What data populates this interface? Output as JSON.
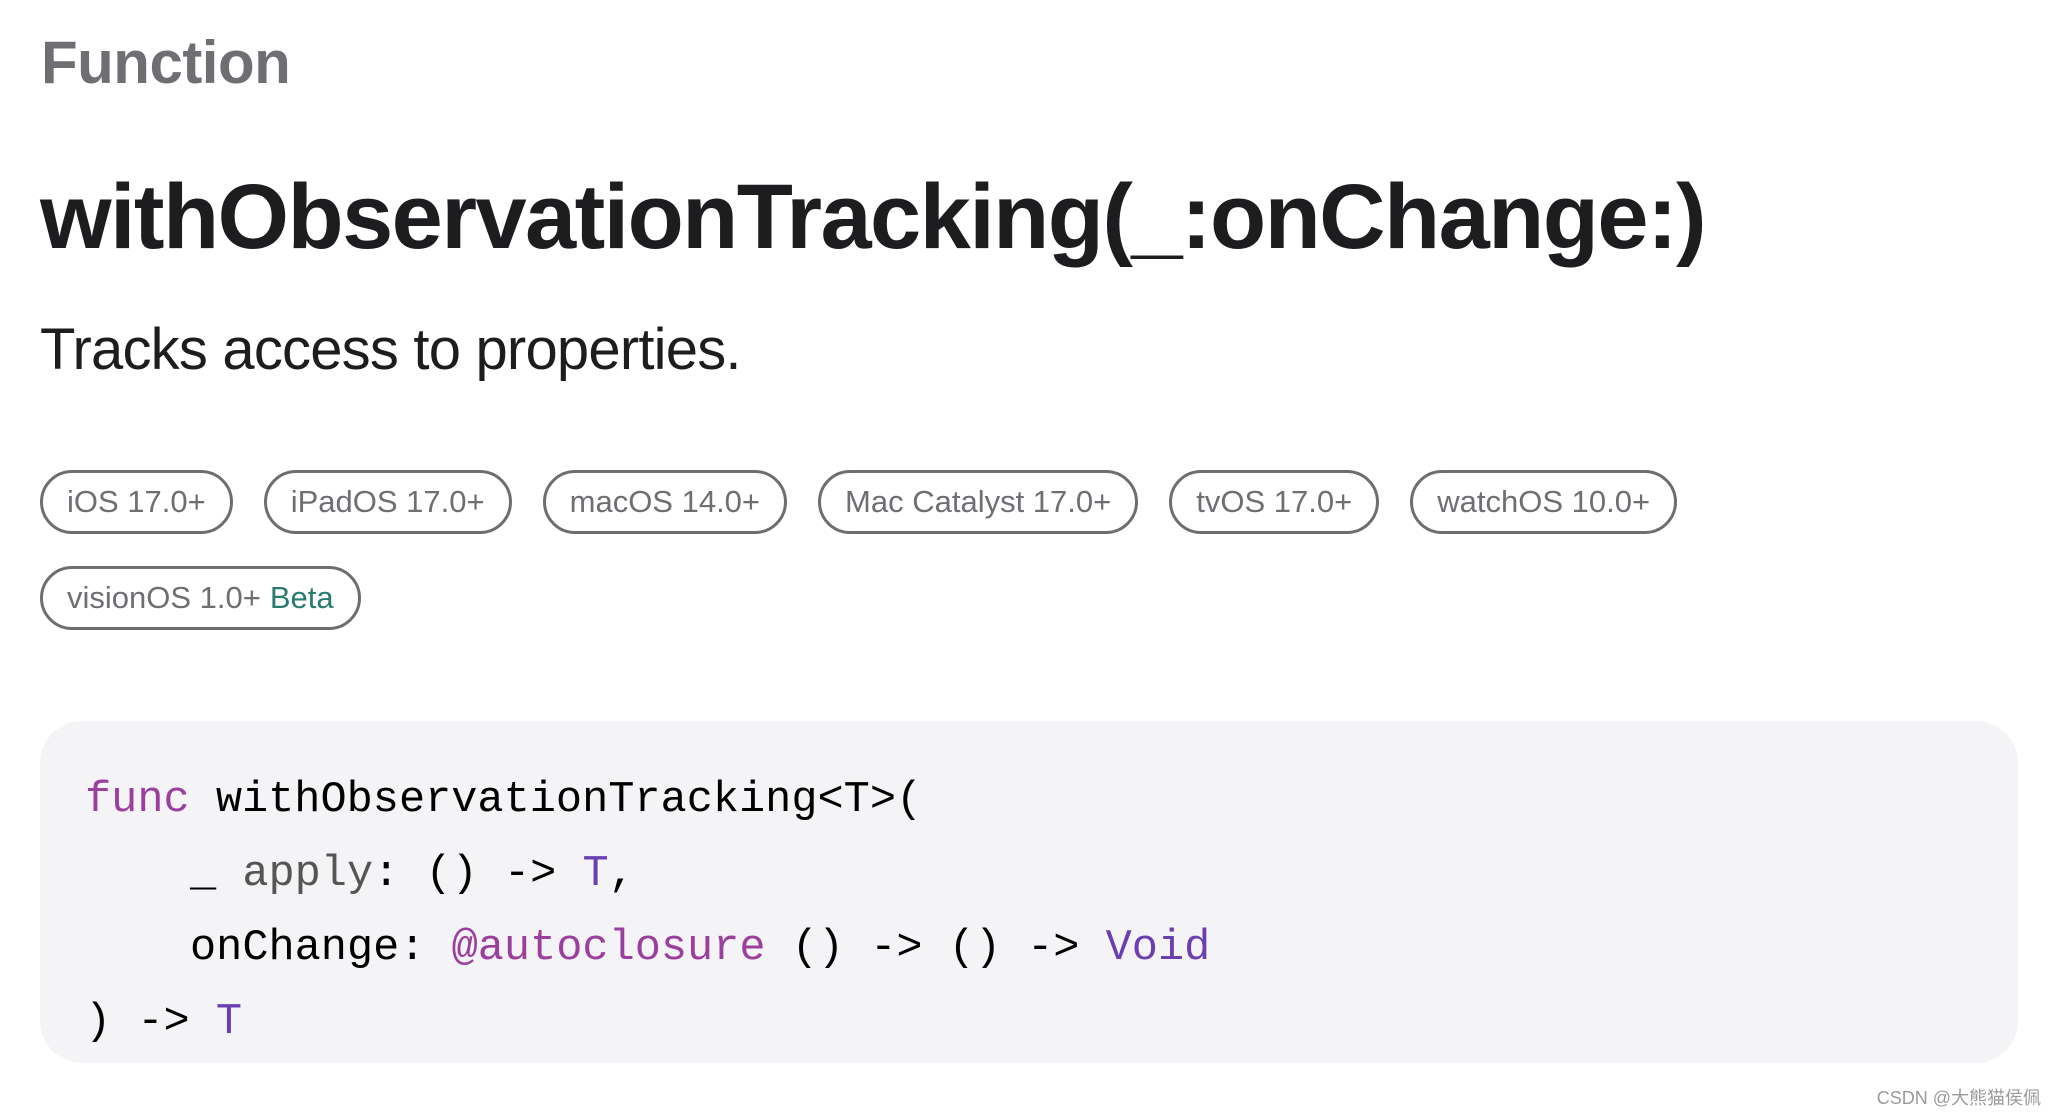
{
  "page": {
    "kind_label": "Function",
    "title": "withObservationTracking(_:onChange:)",
    "abstract": "Tracks access to properties."
  },
  "availability": [
    {
      "platform": "iOS",
      "version": "17.0+",
      "beta": false
    },
    {
      "platform": "iPadOS",
      "version": "17.0+",
      "beta": false
    },
    {
      "platform": "macOS",
      "version": "14.0+",
      "beta": false
    },
    {
      "platform": "Mac Catalyst",
      "version": "17.0+",
      "beta": false
    },
    {
      "platform": "tvOS",
      "version": "17.0+",
      "beta": false
    },
    {
      "platform": "watchOS",
      "version": "10.0+",
      "beta": false
    },
    {
      "platform": "visionOS",
      "version": "1.0+",
      "beta": true,
      "beta_label": "Beta"
    }
  ],
  "badges": {
    "ios": "iOS 17.0+",
    "ipados": "iPadOS 17.0+",
    "macos": "macOS 14.0+",
    "maccatalyst": "Mac Catalyst 17.0+",
    "tvos": "tvOS 17.0+",
    "watchos": "watchOS 10.0+",
    "visionos": "visionOS 1.0+",
    "beta_label": "Beta"
  },
  "declaration": {
    "line1": {
      "keyword": "func",
      "name": " withObservationTracking<T>("
    },
    "line2": {
      "underscore": "_ ",
      "param": "apply",
      "rest": ": () -> ",
      "return_type": "T",
      "trailing": ","
    },
    "line3": {
      "label": "onChange: ",
      "attribute": "@autoclosure",
      "rest": " () -> () -> ",
      "return_type": "Void"
    },
    "line4": {
      "rest": ") -> ",
      "return_type": "T"
    }
  },
  "colors": {
    "keyword": "#9b3f9e",
    "type": "#6b3fb0",
    "beta": "#2a7b6f",
    "code_background": "#f4f4f7",
    "eyebrow": "#6e6e73"
  },
  "watermark": "CSDN @大熊猫侯佩"
}
